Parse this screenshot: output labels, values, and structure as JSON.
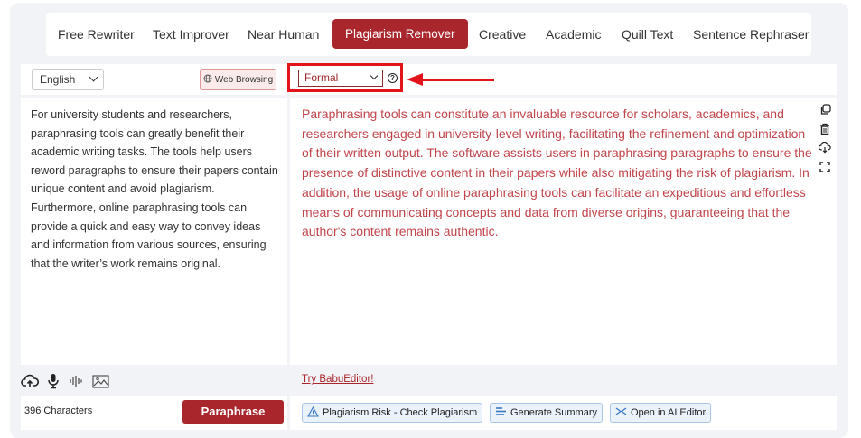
{
  "tabs": [
    "Free Rewriter",
    "Text Improver",
    "Near Human",
    "Plagiarism Remover",
    "Creative",
    "Academic",
    "Quill Text",
    "Sentence Rephraser"
  ],
  "active_tab": "Plagiarism Remover",
  "language": {
    "selected": "English"
  },
  "web_browsing_label": "Web Browsing",
  "mode": {
    "selected": "Formal"
  },
  "input_text": "For university students and researchers, paraphrasing tools can greatly benefit their academic writing tasks. The tools help users reword paragraphs to ensure their papers contain unique content and avoid plagiarism. Furthermore, online paraphrasing tools can provide a quick and easy way to convey ideas and information from various sources, ensuring that the writer’s work remains original.",
  "output_text": "Paraphrasing tools can constitute an invaluable resource for scholars, academics, and researchers engaged in university-level writing, facilitating the refinement and optimization of their written output. The software assists users in paraphrasing paragraphs to ensure the presence of distinctive content in their papers while also mitigating the risk of plagiarism. In addition, the usage of online paraphrasing tools can facilitate an expeditious and effortless means of communicating concepts and data from diverse origins, guaranteeing that the author's content remains authentic.",
  "try_link": "Try BabuEditor!",
  "char_count": "396 Characters",
  "paraphrase_label": "Paraphrase",
  "actions": {
    "plagiarism_check": "Plagiarism Risk - Check Plagiarism",
    "generate_summary": "Generate Summary",
    "open_ai_editor": "Open in AI Editor"
  },
  "colors": {
    "accent": "#a8262c",
    "annotation": "#e2131b",
    "output_text": "#c0454b"
  },
  "icons": [
    "web-icon",
    "help-icon",
    "copy-icon",
    "trash-icon",
    "cloud-download-icon",
    "fullscreen-icon",
    "upload-cloud-icon",
    "microphone-icon",
    "audio-wave-icon",
    "image-icon",
    "warning-icon",
    "summary-icon",
    "ai-editor-icon"
  ]
}
